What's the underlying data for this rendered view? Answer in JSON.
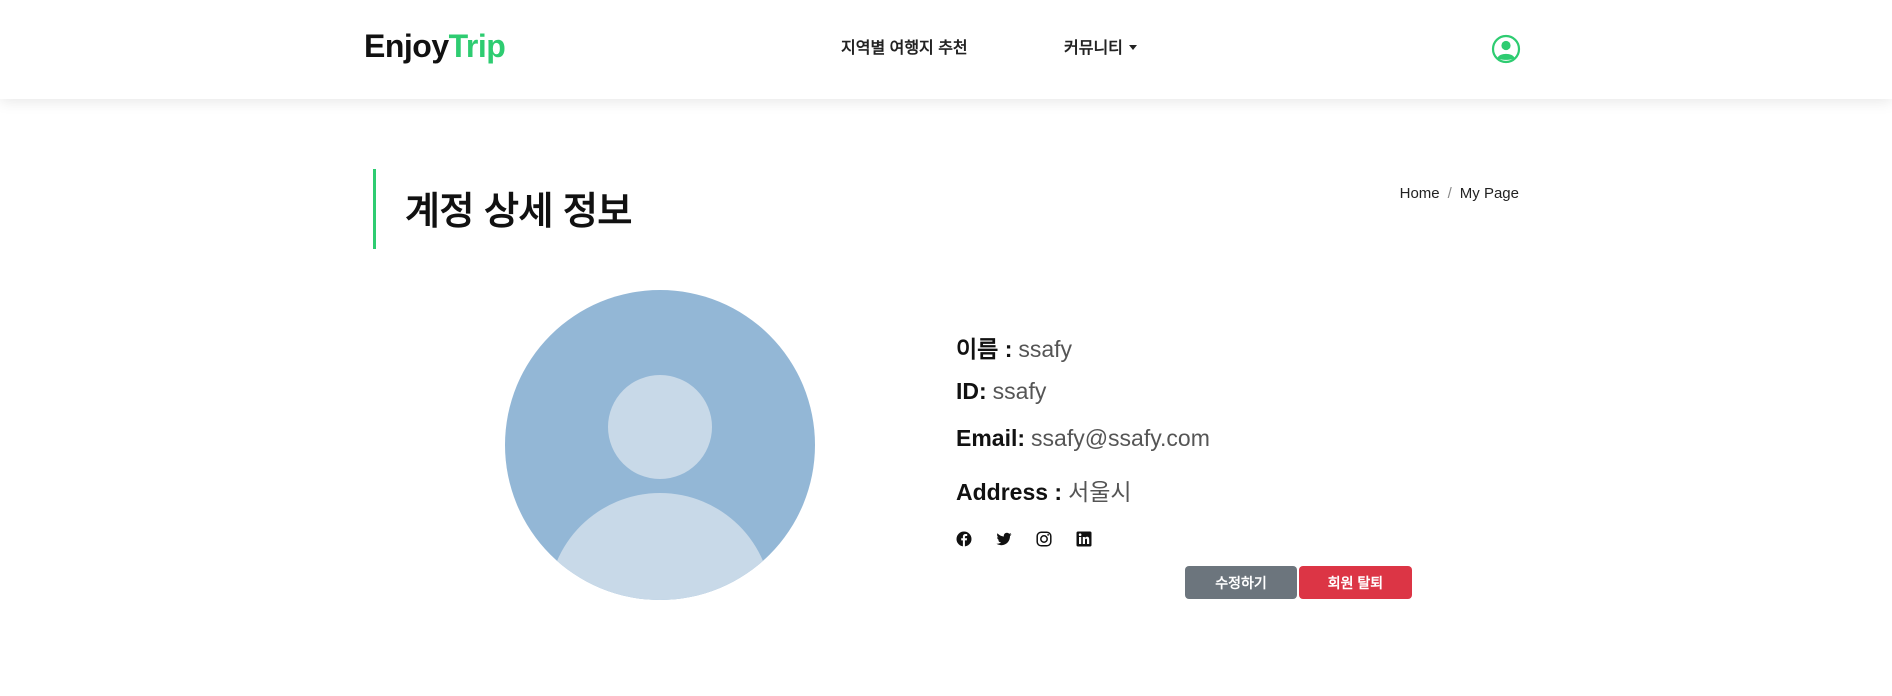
{
  "header": {
    "logo_part1": "Enjoy",
    "logo_part2": "Trip",
    "nav": [
      {
        "label": "지역별 여행지 추천"
      },
      {
        "label": "커뮤니티"
      }
    ],
    "user_icon": "user-circle-icon"
  },
  "page": {
    "title": "계정 상세 정보",
    "breadcrumb": [
      "Home",
      "My Page"
    ]
  },
  "profile": {
    "avatar_icon": "default-avatar",
    "name_label": "이름 :",
    "name_value": "ssafy",
    "id_label": "ID:",
    "id_value": "ssafy",
    "email_label": "Email:",
    "email_value": "ssafy@ssafy.com",
    "address_label": "Address :",
    "address_value": "서울시",
    "socials": [
      "facebook-icon",
      "twitter-icon",
      "instagram-icon",
      "linkedin-icon"
    ]
  },
  "actions": {
    "edit_label": "수정하기",
    "delete_label": "회원 탈퇴"
  },
  "colors": {
    "accent": "#2ecc71",
    "edit_button": "#6c757d",
    "delete_button": "#dc3545",
    "avatar_bg": "#93b7d6",
    "avatar_fg": "#c8d9e8"
  }
}
